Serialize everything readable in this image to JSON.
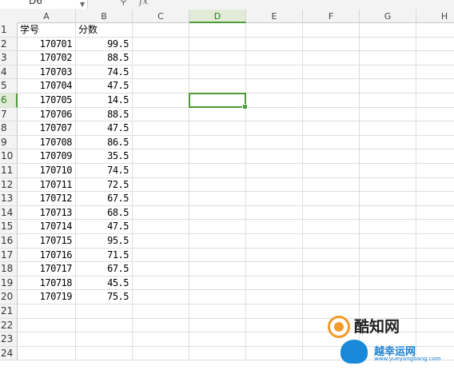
{
  "namebox": {
    "value": "D6"
  },
  "toolbar": {
    "zoom_icon": "magnifier-icon",
    "fx_label": "fx"
  },
  "columns": [
    "A",
    "B",
    "C",
    "D",
    "E",
    "F",
    "G",
    "H"
  ],
  "active_column": "D",
  "active_row": 6,
  "rows": [
    {
      "n": "1",
      "a": "学号",
      "b": "分数"
    },
    {
      "n": "2",
      "a": "170701",
      "b": "99.5"
    },
    {
      "n": "3",
      "a": "170702",
      "b": "88.5"
    },
    {
      "n": "4",
      "a": "170703",
      "b": "74.5"
    },
    {
      "n": "5",
      "a": "170704",
      "b": "47.5"
    },
    {
      "n": "6",
      "a": "170705",
      "b": "14.5"
    },
    {
      "n": "7",
      "a": "170706",
      "b": "88.5"
    },
    {
      "n": "8",
      "a": "170707",
      "b": "47.5"
    },
    {
      "n": "9",
      "a": "170708",
      "b": "86.5"
    },
    {
      "n": "10",
      "a": "170709",
      "b": "35.5"
    },
    {
      "n": "11",
      "a": "170710",
      "b": "74.5"
    },
    {
      "n": "12",
      "a": "170711",
      "b": "72.5"
    },
    {
      "n": "13",
      "a": "170712",
      "b": "67.5"
    },
    {
      "n": "14",
      "a": "170713",
      "b": "68.5"
    },
    {
      "n": "15",
      "a": "170714",
      "b": "47.5"
    },
    {
      "n": "16",
      "a": "170715",
      "b": "95.5"
    },
    {
      "n": "17",
      "a": "170716",
      "b": "71.5"
    },
    {
      "n": "18",
      "a": "170717",
      "b": "67.5"
    },
    {
      "n": "19",
      "a": "170718",
      "b": "45.5"
    },
    {
      "n": "20",
      "a": "170719",
      "b": "75.5"
    },
    {
      "n": "21",
      "a": "",
      "b": ""
    },
    {
      "n": "22",
      "a": "",
      "b": ""
    },
    {
      "n": "23",
      "a": "",
      "b": ""
    },
    {
      "n": "24",
      "a": "",
      "b": ""
    }
  ],
  "watermark": {
    "brand1": "酷知网",
    "brand2": "越幸运网",
    "url": "www.yueyangbang.com",
    "accent_orange": "#f39a2b",
    "accent_blue": "#1a8ad8"
  },
  "colors": {
    "selection": "#4c9a3a",
    "header_bg": "#f3f3f3",
    "gridline": "#dedede"
  }
}
